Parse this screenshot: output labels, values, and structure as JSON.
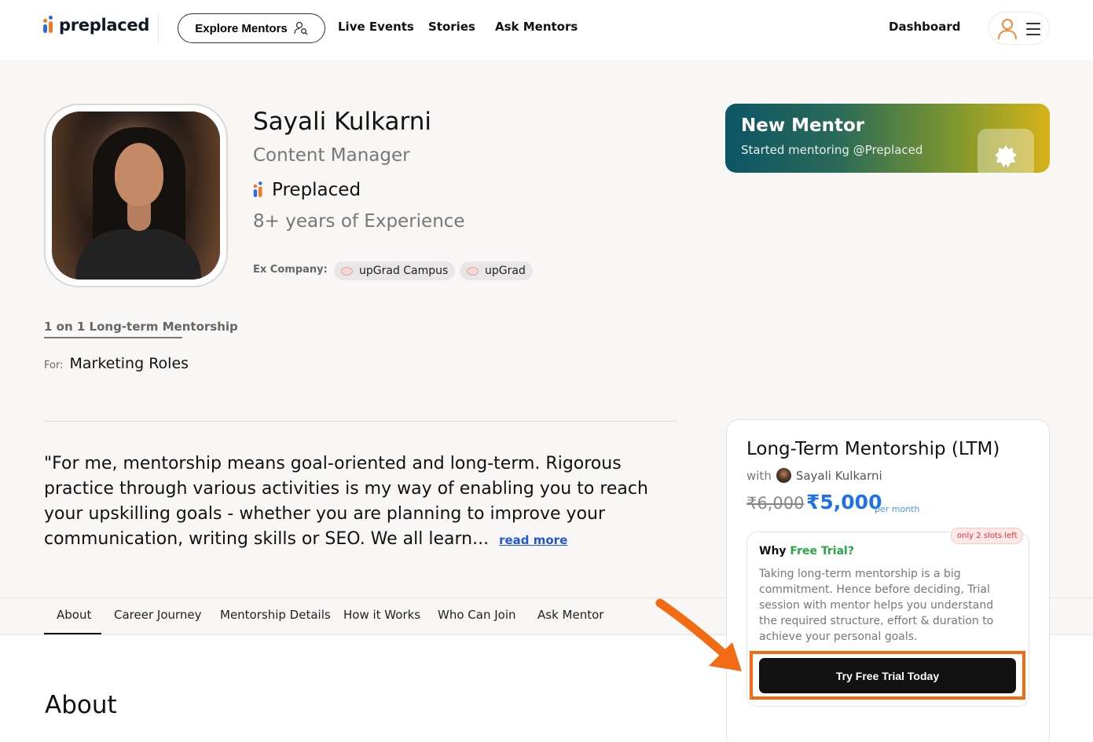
{
  "nav": {
    "logo_text": "preplaced",
    "explore_label": "Explore Mentors",
    "links": [
      "Live Events",
      "Stories",
      "Ask Mentors"
    ],
    "dashboard_label": "Dashboard",
    "icons": [
      "user-search-icon",
      "user-icon",
      "hamburger-menu-icon"
    ]
  },
  "profile": {
    "name": "Sayali Kulkarni",
    "role": "Content Manager",
    "company": "Preplaced",
    "experience": "8+ years of Experience",
    "ex_company_label": "Ex Company:",
    "ex_companies": [
      "upGrad Campus",
      "upGrad"
    ],
    "mentorship_type": "1 on 1 Long-term Mentorship",
    "for_label": "For:",
    "for_value": "Marketing Roles",
    "quote": "\"For me, mentorship means goal-oriented and long-term. Rigorous practice through various activities is my way of enabling you to reach your upskilling goals - whether you are planning to improve your communication, writing skills or SEO. We all learn...",
    "read_more": "read more"
  },
  "banner": {
    "title": "New Mentor",
    "subtitle": "Started mentoring @Preplaced",
    "badge_icon": "new-badge-icon",
    "gradient": [
      "#0d5566",
      "#d6b31a"
    ]
  },
  "tabs": {
    "items": [
      "About",
      "Career Journey",
      "Mentorship Details",
      "How it Works",
      "Who Can Join",
      "Ask Mentor"
    ],
    "active": "About"
  },
  "about_heading": "About",
  "pricing": {
    "title": "Long-Term Mentorship (LTM)",
    "with_label": "with",
    "mentor_name": "Sayali Kulkarni",
    "old_price": "₹6,000",
    "new_price": "₹5,000",
    "period": "per month",
    "slots_badge": "only 2 slots left",
    "why_prefix": "Why",
    "why_highlight": "Free Trial?",
    "why_text": "Taking long-term mentorship is a big commitment. Hence before deciding, Trial session with mentor helps you understand the required structure, effort & duration to achieve your personal goals.",
    "cta_label": "Try Free Trial Today"
  },
  "colors": {
    "accent_blue": "#1f72e6",
    "highlight_orange": "#f26a12",
    "trial_green": "#28a745",
    "slots_red": "#e03535"
  }
}
